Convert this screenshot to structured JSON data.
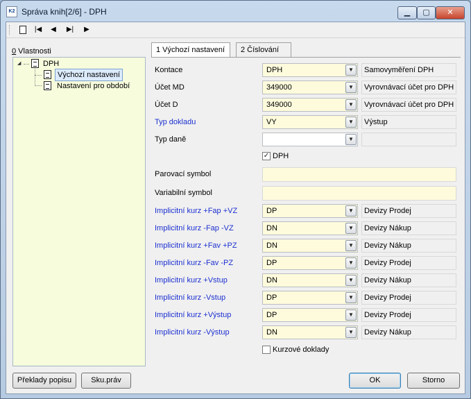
{
  "window": {
    "app_icon_text": "K2",
    "title": "Správa knih[2/6] - DPH",
    "controls": {
      "minimize": "▁",
      "maximize": "▢",
      "close": "✕"
    }
  },
  "toolbar": {
    "first": "|◀",
    "prev": "◀",
    "next": "▶|",
    "play": "▶"
  },
  "properties_label_key": "0",
  "properties_label_rest": " Vlastnosti",
  "tree": {
    "root": "DPH",
    "children": [
      "Výchozí nastavení",
      "Nastavení pro období"
    ]
  },
  "tabs": [
    "1 Výchozí nastavení",
    "2 Číslování"
  ],
  "form": {
    "kontace": {
      "label": "Kontace",
      "value": "DPH",
      "desc": "Samovyměření DPH"
    },
    "ucet_md": {
      "label": "Účet MD",
      "value": "349000",
      "desc": "Vyrovnávací účet pro DPH"
    },
    "ucet_d": {
      "label": "Účet D",
      "value": "349000",
      "desc": "Vyrovnávací účet pro DPH"
    },
    "typ_dokladu": {
      "label": "Typ dokladu",
      "value": "VY",
      "desc": "Výstup"
    },
    "typ_dane": {
      "label": "Typ daně",
      "value": "",
      "desc": ""
    },
    "dph_checkbox": {
      "label": "DPH",
      "checked": true
    },
    "parovaci": {
      "label": "Parovací symbol",
      "value": ""
    },
    "variabilni": {
      "label": "Variabilní symbol",
      "value": ""
    },
    "kurzy": [
      {
        "label": "Implicitní kurz +Fap +VZ",
        "value": "DP",
        "desc": "Devizy Prodej"
      },
      {
        "label": "Implicitní kurz -Fap -VZ",
        "value": "DN",
        "desc": "Devizy Nákup"
      },
      {
        "label": "Implicitní kurz +Fav +PZ",
        "value": "DN",
        "desc": "Devizy Nákup"
      },
      {
        "label": "Implicitní kurz -Fav -PZ",
        "value": "DP",
        "desc": "Devizy Prodej"
      },
      {
        "label": "Implicitní kurz +Vstup",
        "value": "DN",
        "desc": "Devizy Nákup"
      },
      {
        "label": "Implicitní kurz -Vstup",
        "value": "DP",
        "desc": "Devizy Prodej"
      },
      {
        "label": "Implicitní kurz +Výstup",
        "value": "DP",
        "desc": "Devizy Prodej"
      },
      {
        "label": "Implicitní kurz -Výstup",
        "value": "DN",
        "desc": "Devizy Nákup"
      }
    ],
    "kurzove_checkbox": {
      "label": "Kurzové doklady",
      "checked": false
    }
  },
  "dropdown_glyph": "▼",
  "check_glyph": "✓",
  "buttons": {
    "preklady": "Překlady popisu",
    "sku_prav": "Sku.práv",
    "ok": "OK",
    "storno": "Storno"
  },
  "colors": {
    "field_bg": "#fdfbdc",
    "tree_bg": "#f6fcdc",
    "link_label": "#1b2fd0"
  }
}
